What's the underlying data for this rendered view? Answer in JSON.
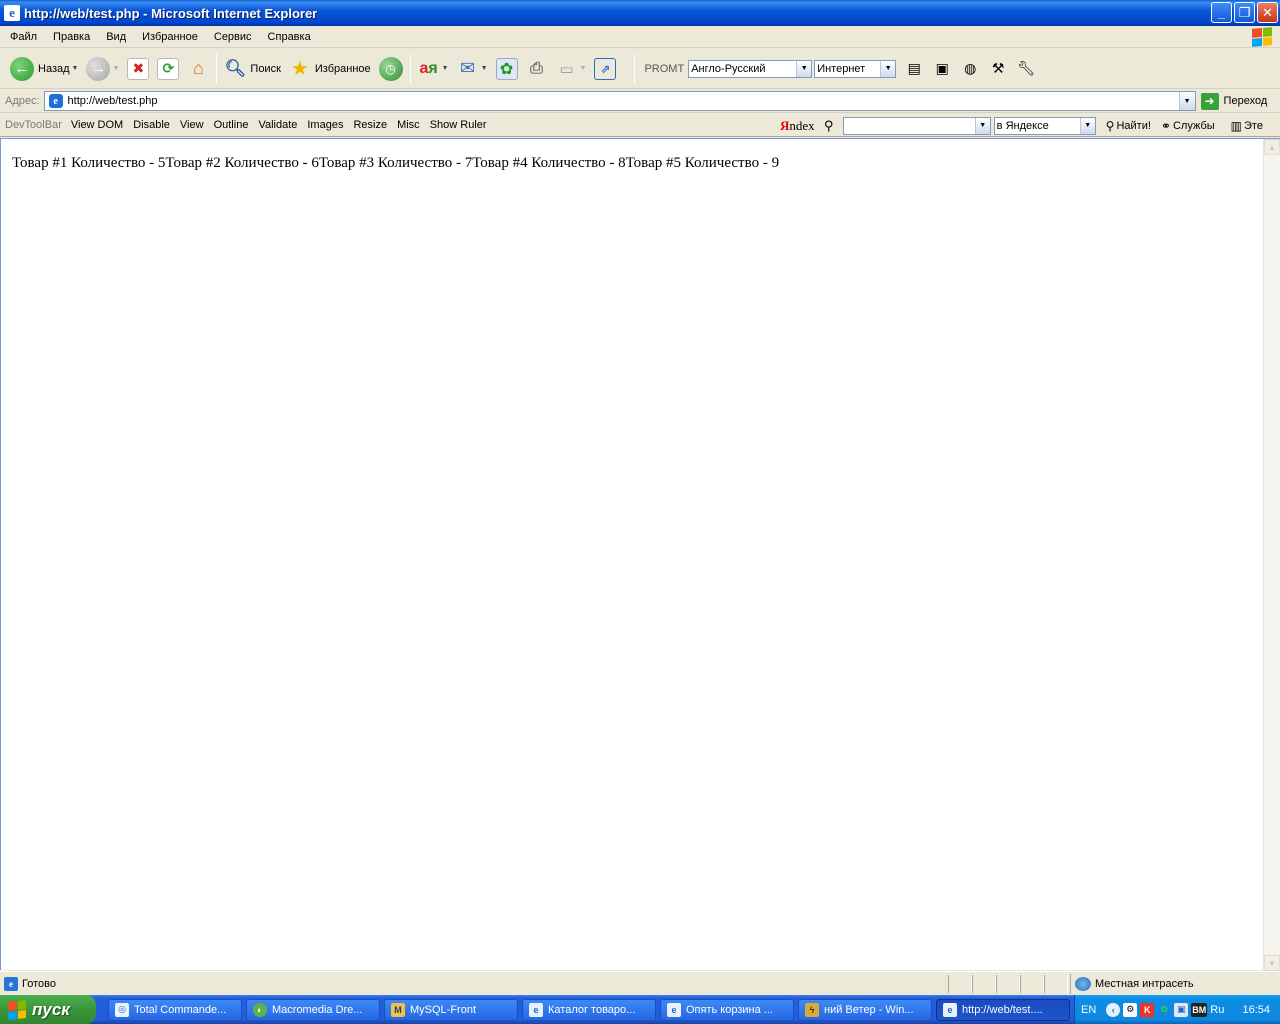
{
  "window": {
    "title": "http://web/test.php - Microsoft Internet Explorer"
  },
  "menu": [
    "Файл",
    "Правка",
    "Вид",
    "Избранное",
    "Сервис",
    "Справка"
  ],
  "toolbar": {
    "back_label": "Назад",
    "search_label": "Поиск",
    "favorites_label": "Избранное",
    "promt_label": "PROMT",
    "translation_direction": "Англо-Русский",
    "translation_profile": "Интернет"
  },
  "address": {
    "label": "Адрес:",
    "url": "http://web/test.php",
    "go_label": "Переход"
  },
  "devtoolbar": {
    "title": "DevToolBar",
    "items": [
      "View DOM",
      "Disable",
      "View",
      "Outline",
      "Validate",
      "Images",
      "Resize",
      "Misc",
      "Show Ruler"
    ]
  },
  "yandex": {
    "search_value": "",
    "scope": "в Яндексе",
    "find_label": "Найти!",
    "services_label": "Службы",
    "extra_label": "Эте"
  },
  "page": {
    "text": "Товар #1 Количество - 5Товар #2 Количество - 6Товар #3 Количество - 7Товар #4 Количество - 8Товар #5 Количество - 9"
  },
  "status": {
    "text": "Готово",
    "zone": "Местная интрасеть"
  },
  "taskbar": {
    "start_label": "пуск",
    "tasks": [
      "Total Commande...",
      "Macromedia Dre...",
      "MySQL-Front",
      "Каталог товаро...",
      "Опять корзина ...",
      "ний Ветер - Win...",
      "http://web/test...."
    ],
    "lang": "EN",
    "ru": "Ru",
    "clock": "16:54"
  },
  "colors": {
    "title_bar": "#0856d6",
    "taskbar": "#245edb",
    "start_button": "#3c963c",
    "chrome_bg": "#ece9d8"
  }
}
